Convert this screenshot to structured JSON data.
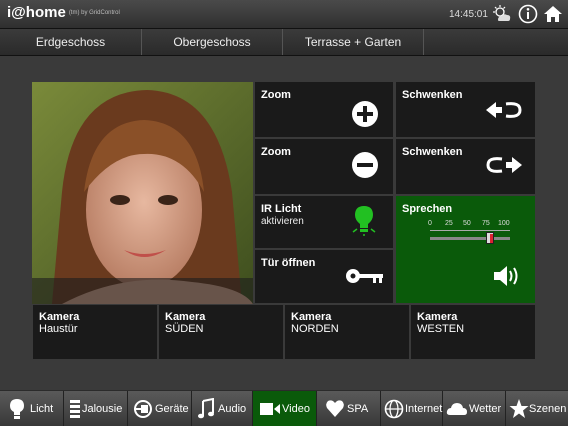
{
  "header": {
    "logo": "i@home",
    "logo_sub": "(tm) by GridControl",
    "time": "14:45:01"
  },
  "floors": [
    "Erdgeschoss",
    "Obergeschoss",
    "Terrasse + Garten"
  ],
  "controls": {
    "zoom_in": "Zoom",
    "zoom_out": "Zoom",
    "pan_left": "Schwenken",
    "pan_right": "Schwenken",
    "ir_label": "IR Licht",
    "ir_sub": "aktivieren",
    "door_label": "Tür öffnen",
    "speak_label": "Sprechen",
    "volume_ticks": [
      "0",
      "25",
      "50",
      "75",
      "100"
    ],
    "volume_level": 75
  },
  "cameras": [
    {
      "label": "Kamera",
      "sub": "Haustür",
      "active": true
    },
    {
      "label": "Kamera",
      "sub": "SÜDEN",
      "active": false
    },
    {
      "label": "Kamera",
      "sub": "NORDEN",
      "active": false
    },
    {
      "label": "Kamera",
      "sub": "WESTEN",
      "active": false
    }
  ],
  "nav": [
    {
      "label": "Licht",
      "icon": "lamp-icon"
    },
    {
      "label": "Jalousie",
      "icon": "blinds-icon"
    },
    {
      "label": "Geräte",
      "icon": "plug-icon"
    },
    {
      "label": "Audio",
      "icon": "music-note-icon"
    },
    {
      "label": "Video",
      "icon": "video-camera-icon",
      "active": true
    },
    {
      "label": "SPA",
      "icon": "heart-icon"
    },
    {
      "label": "Internet",
      "icon": "globe-icon"
    },
    {
      "label": "Wetter",
      "icon": "cloud-icon"
    },
    {
      "label": "Szenen",
      "icon": "star-icon"
    }
  ],
  "colors": {
    "accent": "#0a5a0a",
    "panel": "#1a1a1a"
  }
}
